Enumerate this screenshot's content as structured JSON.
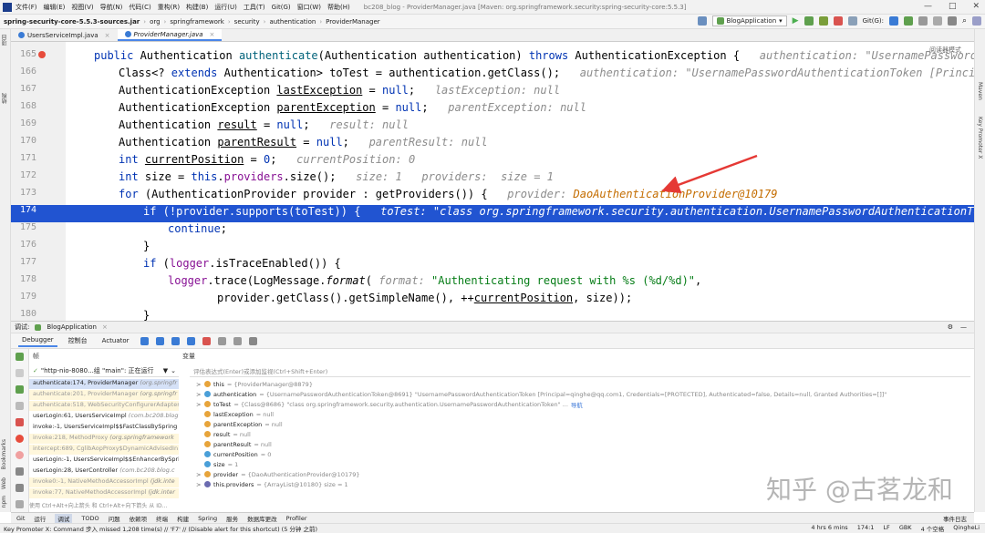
{
  "menubar": {
    "items": [
      "文件(F)",
      "编辑(E)",
      "视图(V)",
      "导航(N)",
      "代码(C)",
      "重构(R)",
      "构建(B)",
      "运行(U)",
      "工具(T)",
      "Git(G)",
      "窗口(W)",
      "帮助(H)"
    ],
    "window_title": "bc208_blog - ProviderManager.java [Maven: org.springframework.security:spring-security-core:5.5.3]"
  },
  "navbar": {
    "crumbs": [
      "spring-security-core-5.5.3-sources.jar",
      "org",
      "springframework",
      "security",
      "authentication",
      "ProviderManager"
    ],
    "run_config": "BlogApplication",
    "git_label": "Git(G):"
  },
  "editor_tabs": [
    {
      "label": "UsersServiceImpl.java",
      "active": false
    },
    {
      "label": "ProviderManager.java",
      "active": true
    }
  ],
  "editor": {
    "reader_mode": "阅读器模式",
    "lines": [
      {
        "n": "165",
        "code": "public Authentication authenticate(Authentication authentication) throws AuthenticationException {",
        "hint": "authentication: \"UsernamePasswordAuthent"
      },
      {
        "n": "166",
        "code": "Class<? extends Authentication> toTest = authentication.getClass();",
        "hint": "authentication: \"UsernamePasswordAuthenticationToken [Principal=qinghe"
      },
      {
        "n": "167",
        "code": "AuthenticationException lastException = null;",
        "hint": "lastException: null"
      },
      {
        "n": "168",
        "code": "AuthenticationException parentException = null;",
        "hint": "parentException: null"
      },
      {
        "n": "169",
        "code": "Authentication result = null;",
        "hint": "result: null"
      },
      {
        "n": "170",
        "code": "Authentication parentResult = null;",
        "hint": "parentResult: null"
      },
      {
        "n": "171",
        "code": "int currentPosition = 0;",
        "hint": "currentPosition: 0"
      },
      {
        "n": "172",
        "code": "int size = this.providers.size();",
        "hint": "size: 1    providers:  size = 1"
      },
      {
        "n": "173",
        "code": "for (AuthenticationProvider provider : getProviders()) {",
        "hint": "provider: ",
        "hint_obj": "DaoAuthenticationProvider@10179"
      },
      {
        "n": "174",
        "code": "if (!provider.supports(toTest)) {",
        "hint": "toTest: \"class org.springframework.security.authentication.UsernamePasswordAuthenticationToken\"",
        "current": true
      },
      {
        "n": "175",
        "code": "continue;"
      },
      {
        "n": "176",
        "code": "}"
      },
      {
        "n": "177",
        "code": "if (logger.isTraceEnabled()) {"
      },
      {
        "n": "178",
        "code": "logger.trace(LogMessage.format( format: \"Authenticating request with %s (%d/%d)\","
      },
      {
        "n": "179",
        "code": "provider.getClass().getSimpleName(), ++currentPosition, size));"
      },
      {
        "n": "180",
        "code": "}"
      }
    ]
  },
  "debug": {
    "header_label": "调试:",
    "session": "BlogApplication",
    "tabs": [
      "Debugger",
      "控制台",
      "Actuator"
    ],
    "frames_label": "帧",
    "vars_label": "变量",
    "thread": "\"http-nio-8080...组 \"main\": 正在运行",
    "frames": [
      {
        "fn": "authenticate:174, ProviderManager",
        "cls": "(org.springfr",
        "kind": "sel"
      },
      {
        "fn": "authenticate:201, ProviderManager",
        "cls": "(org.springfr",
        "kind": "lib"
      },
      {
        "fn": "authenticate:518, WebSecurityConfigurerAdapter",
        "cls": "",
        "kind": "lib"
      },
      {
        "fn": "userLogin:61, UsersServiceImpl",
        "cls": "(com.bc208.blog",
        "kind": "normal"
      },
      {
        "fn": "invoke:-1, UsersServiceImpl$$FastClassBySpring",
        "cls": "",
        "kind": "normal"
      },
      {
        "fn": "invoke:218, MethodProxy",
        "cls": "(org.springframework",
        "kind": "lib"
      },
      {
        "fn": "intercept:689, CglibAopProxy$DynamicAdvisedIn",
        "cls": "",
        "kind": "lib"
      },
      {
        "fn": "userLogin:-1, UsersServiceImpl$$EnhancerBySpri",
        "cls": "",
        "kind": "normal"
      },
      {
        "fn": "userLogin:28, UserController",
        "cls": "(com.bc208.blog.c",
        "kind": "normal"
      },
      {
        "fn": "invoke0:-1, NativeMethodAccessorImpl",
        "cls": "(jdk.inte",
        "kind": "lib"
      },
      {
        "fn": "invoke:77, NativeMethodAccessorImpl",
        "cls": "(jdk.inter",
        "kind": "lib"
      }
    ],
    "frames_hint": "使用 Ctrl+Alt+向上箭头 和 Ctrl+Alt+向下箭头 从 ID...",
    "eval_placeholder": "评估表达式(Enter)或添加监视(Ctrl+Shift+Enter)",
    "vars": [
      {
        "arrow": ">",
        "badge": "p",
        "name": "this",
        "val": " = {ProviderManager@8879}"
      },
      {
        "arrow": ">",
        "badge": "p",
        "name": "authentication",
        "val": " = {UsernamePasswordAuthenticationToken@8691} \"UsernamePasswordAuthenticationToken [Principal=qinghe@qq.com1, Credentials=[PROTECTED], Authenticated=false, Details=null, Granted Authorities=[]]\""
      },
      {
        "arrow": ">",
        "badge": "p",
        "name": "toTest",
        "val": " = {Class@8686} \"class org.springframework.security.authentication.UsernamePasswordAuthenticationToken\" ... ",
        "link": "导航"
      },
      {
        "arrow": "",
        "badge": "p",
        "name": "lastException",
        "val": " = null"
      },
      {
        "arrow": "",
        "badge": "p",
        "name": "parentException",
        "val": " = null"
      },
      {
        "arrow": "",
        "badge": "p",
        "name": "result",
        "val": " = null"
      },
      {
        "arrow": "",
        "badge": "p",
        "name": "parentResult",
        "val": " = null"
      },
      {
        "arrow": "",
        "badge": "p",
        "name": "currentPosition",
        "val": " = 0"
      },
      {
        "arrow": "",
        "badge": "p",
        "name": "size",
        "val": " = 1"
      },
      {
        "arrow": ">",
        "badge": "p",
        "name": "provider",
        "val": " = {DaoAuthenticationProvider@10179}"
      },
      {
        "arrow": ">",
        "badge": "oo",
        "name": "this.providers",
        "val": " = {ArrayList@10180}  size = 1"
      }
    ]
  },
  "bottom_tabs": [
    "Git",
    "运行",
    "调试",
    "TODO",
    "问题",
    "依赖项",
    "终端",
    "构建",
    "Spring",
    "服务",
    "数据库更改",
    "Profiler"
  ],
  "bottom_right": "事件日志",
  "statusbar": {
    "message": "Key Promoter X: Command 步入 missed 1,208 time(s) // 'F7' // (Disable alert for this shortcut) (5 分钟 之前)",
    "time": "4 hrs 6 mins",
    "pos": "174:1",
    "lf": "LF",
    "enc": "GBK",
    "indent": "4 个空格",
    "user": "QingheLi"
  },
  "left_stripe": [
    "项目",
    "结构",
    "Bookmarks",
    "Web",
    "npm"
  ],
  "right_stripe": [
    "Maven",
    "Key Promoter X"
  ],
  "watermark": "知乎 @古茗龙和"
}
